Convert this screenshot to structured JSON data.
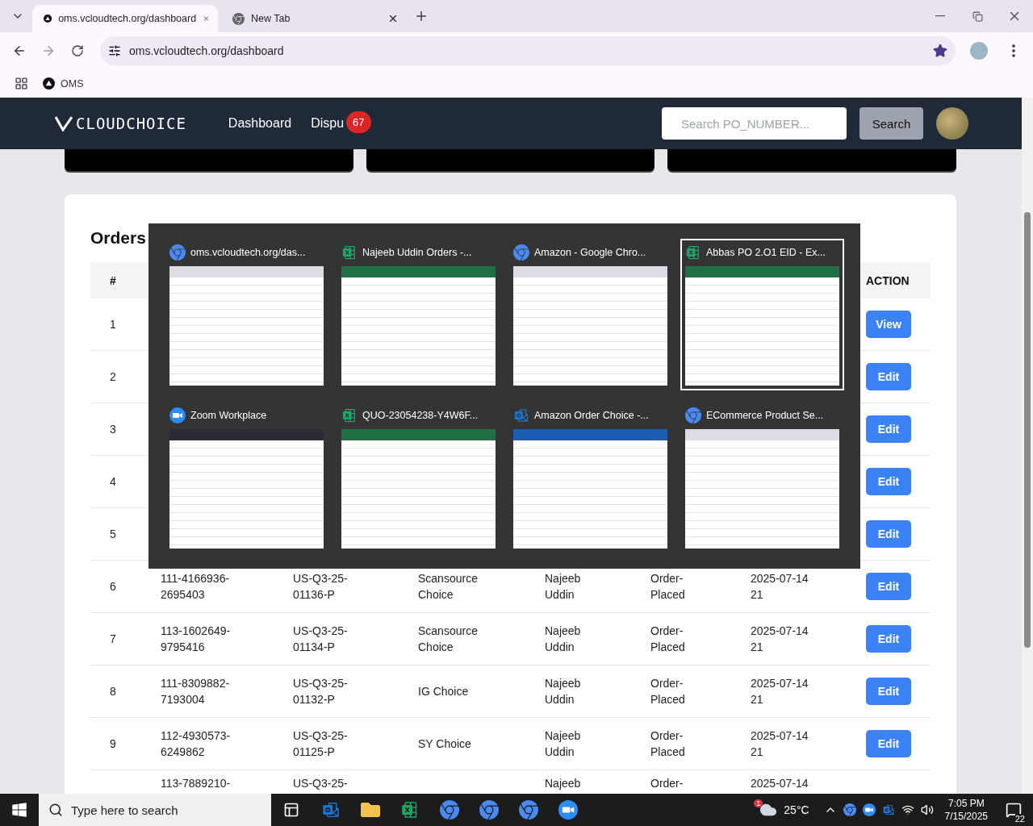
{
  "browser": {
    "tabs": [
      {
        "title": "oms.vcloudtech.org/dashboard",
        "kind": "site",
        "selected": true
      },
      {
        "title": "New Tab",
        "kind": "chrome",
        "selected": false
      }
    ],
    "address": "oms.vcloudtech.org/dashboard",
    "bookmarks": [
      {
        "label": "OMS"
      }
    ]
  },
  "navbar": {
    "logo": "CLOUDCHOICE",
    "links": [
      {
        "label": "Dashboard"
      },
      {
        "label": "Dispu",
        "badge": "67"
      }
    ],
    "search": {
      "placeholder": "Search PO_NUMBER..."
    },
    "search_button": "Search"
  },
  "orders": {
    "title": "Orders",
    "columns": {
      "first": "#",
      "last": "ACTION"
    },
    "rows": [
      {
        "index": "1",
        "action": "View"
      },
      {
        "index": "2",
        "action": "Edit"
      },
      {
        "index": "3",
        "action": "Edit"
      },
      {
        "index": "4",
        "action": "Edit"
      },
      {
        "index": "5",
        "action": "Edit"
      },
      {
        "index": "6",
        "order": "111-4166936-2695403",
        "po": "US-Q3-25-01136-P",
        "supplier": "Scansource Choice",
        "user": "Najeeb Uddin",
        "status": "Order-Placed",
        "date": "2025-07-14 21",
        "action": "Edit"
      },
      {
        "index": "7",
        "order": "113-1602649-9795416",
        "po": "US-Q3-25-01134-P",
        "supplier": "Scansource Choice",
        "user": "Najeeb Uddin",
        "status": "Order-Placed",
        "date": "2025-07-14 21",
        "action": "Edit"
      },
      {
        "index": "8",
        "order": "111-8309882-7193004",
        "po": "US-Q3-25-01132-P",
        "supplier": "IG Choice",
        "user": "Najeeb Uddin",
        "status": "Order-Placed",
        "date": "2025-07-14 21",
        "action": "Edit"
      },
      {
        "index": "9",
        "order": "112-4930573-6249862",
        "po": "US-Q3-25-01125-P",
        "supplier": "SY Choice",
        "user": "Najeeb Uddin",
        "status": "Order-Placed",
        "date": "2025-07-14 21",
        "action": "Edit"
      },
      {
        "order": "113-7889210-",
        "po": "US-Q3-25-",
        "user": "Najeeb",
        "status": "Order-",
        "date": "2025-07-14"
      }
    ]
  },
  "task_switcher": {
    "windows": [
      {
        "kind": "chrome",
        "title": "oms.vcloudtech.org/das...",
        "selected": false
      },
      {
        "kind": "excel",
        "title": "Najeeb Uddin Orders -...",
        "selected": false
      },
      {
        "kind": "chrome",
        "title": "Amazon - Google Chro...",
        "selected": false
      },
      {
        "kind": "excel",
        "title": "Abbas PO 2.O1  EID - Ex...",
        "selected": true
      },
      {
        "kind": "zoom",
        "title": "Zoom Workplace",
        "selected": false
      },
      {
        "kind": "excel",
        "title": "QUO-23054238-Y4W6F...",
        "selected": false
      },
      {
        "kind": "outlook",
        "title": "Amazon Order Choice -...",
        "selected": false
      },
      {
        "kind": "chrome",
        "title": "ECommerce Product Se...",
        "selected": false
      }
    ]
  },
  "taskbar": {
    "search_placeholder": "Type here to search",
    "apps": [
      {
        "kind": "outlook"
      },
      {
        "kind": "folder"
      },
      {
        "kind": "excel"
      },
      {
        "kind": "chrome"
      },
      {
        "kind": "chrome"
      },
      {
        "kind": "chrome"
      },
      {
        "kind": "zoom"
      }
    ],
    "weather": {
      "temperature": "25°C",
      "alert": "1"
    },
    "time": "7:05 PM",
    "date": "7/15/2025",
    "notifications": "22"
  }
}
